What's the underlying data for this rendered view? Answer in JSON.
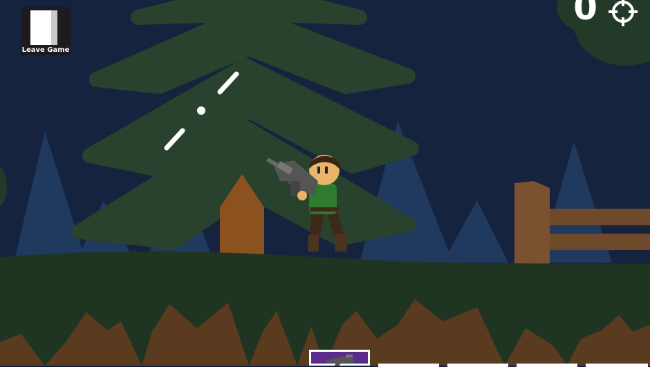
{
  "hud": {
    "leave_label": "Leave Game",
    "score": "0",
    "crosshair_icon": "crosshair-icon",
    "door_icon": "exit-door-icon"
  },
  "hotbar": {
    "selected_slot": 0,
    "slots": [
      "selected-weapon",
      "empty",
      "empty",
      "empty",
      "empty"
    ],
    "selected_color": "#5a2b8a"
  },
  "colors": {
    "sky": "#16233e",
    "ground": "#1f3522",
    "tree": "#28422d",
    "dirt": "#5b3b20",
    "fence": "#6e4a2a",
    "shirt": "#2e7a2e"
  }
}
